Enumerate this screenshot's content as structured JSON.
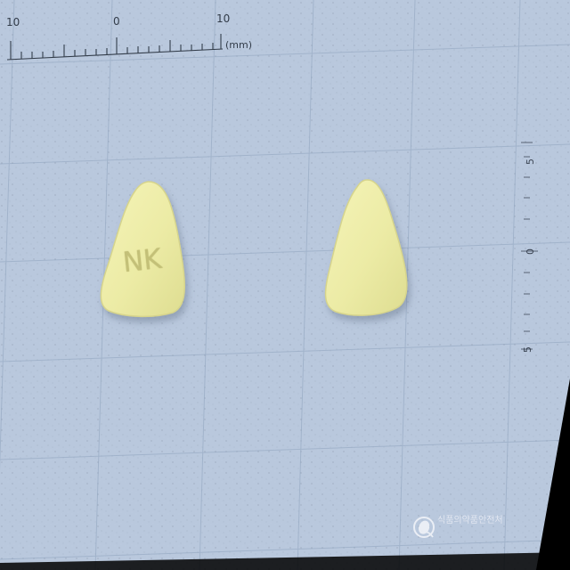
{
  "scene": {
    "background_color": "#b9c8dd",
    "grid_color": "#8fa3bd",
    "pill_color": "#eeeca7",
    "shadow_color": "#7f899a",
    "dark_corner_color": "#000000"
  },
  "ruler": {
    "top_labels": [
      "10",
      "0",
      "10"
    ],
    "unit": "(mm)",
    "side_labels": [
      "5",
      "0",
      "5"
    ]
  },
  "pills": [
    {
      "imprint": "NK"
    },
    {
      "imprint": ""
    }
  ],
  "watermark": {
    "text": "식품의약품안전처",
    "icon": "ministry-logo-icon"
  }
}
